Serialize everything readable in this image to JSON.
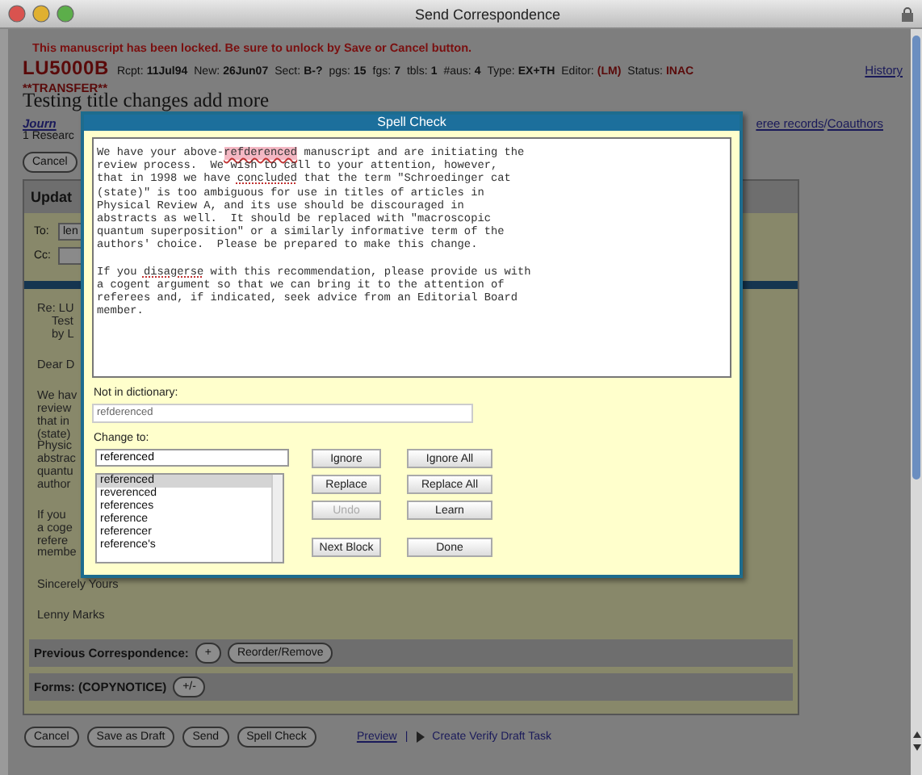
{
  "window": {
    "title": "Send Correspondence"
  },
  "lock_message": "This manuscript has been locked. Be sure to unlock by Save or Cancel button.",
  "manuscript": {
    "code": "LU5000B",
    "fields": [
      {
        "label": "Rcpt:",
        "value": "11Jul94",
        "highlight": false
      },
      {
        "label": "New:",
        "value": "26Jun07",
        "highlight": false
      },
      {
        "label": "Sect:",
        "value": "B-?",
        "highlight": false
      },
      {
        "label": "pgs:",
        "value": "15",
        "highlight": false
      },
      {
        "label": "fgs:",
        "value": "7",
        "highlight": false
      },
      {
        "label": "tbls:",
        "value": "1",
        "highlight": false
      },
      {
        "label": "#aus:",
        "value": "4",
        "highlight": false
      },
      {
        "label": "Type:",
        "value": "EX+TH",
        "highlight": false
      },
      {
        "label": "Editor:",
        "value": "(LM)",
        "highlight": true
      },
      {
        "label": "Status:",
        "value": "INAC",
        "highlight": true
      }
    ],
    "transfer": "**TRANSFER**",
    "history_link": "History",
    "title": "Testing title changes add more",
    "journal_link": "Journ",
    "right_links": [
      "eree records",
      "Coauthors"
    ],
    "link_separator": "/",
    "research_line": "1 Researc"
  },
  "top_buttons": [
    "Cancel"
  ],
  "panel": {
    "header": "Updat",
    "to_label": "To:",
    "to_value": "len",
    "cc_label": "Cc:",
    "letter": [
      [
        {
          "text": "Re: LU",
          "children": [
            {
              "text": "Test"
            },
            {
              "text": "by L"
            }
          ]
        }
      ],
      [
        {
          "text": "Dear D"
        }
      ],
      [
        {
          "text": "We hav"
        },
        {
          "text": "review"
        },
        {
          "text": "that in"
        },
        {
          "text": "(state)"
        },
        {
          "text": "Physic"
        },
        {
          "text": "abstrac"
        },
        {
          "text": "quantu"
        },
        {
          "text": "author"
        }
      ],
      [
        {
          "text": "If you"
        },
        {
          "text": "a coge"
        },
        {
          "text": "refere"
        },
        {
          "text": "membe"
        }
      ],
      [
        {
          "text": "Sincerely Yours"
        }
      ],
      [
        {
          "text": "Lenny Marks"
        }
      ]
    ],
    "sections": [
      {
        "label": "Previous Correspondence:",
        "buttons": [
          "+",
          "Reorder/Remove"
        ]
      },
      {
        "label": "Forms: (COPYNOTICE)",
        "buttons": [
          "+/-"
        ]
      }
    ]
  },
  "bottom_buttons": [
    "Cancel",
    "Save as Draft",
    "Send",
    "Spell Check"
  ],
  "bottom_links": {
    "preview": "Preview",
    "separator": "|",
    "task": "Create Verify Draft Task"
  },
  "spell_check": {
    "title": "Spell Check",
    "paragraphs": [
      [
        [
          {
            "kind": "plain",
            "text": "We have your above-"
          },
          {
            "kind": "current",
            "text": "refderenced"
          },
          {
            "kind": "plain",
            "text": " manuscript and are initiating the"
          }
        ],
        [
          {
            "kind": "plain",
            "text": "review process.  We wish to call to your attention, however,"
          }
        ],
        [
          {
            "kind": "plain",
            "text": "that in 1998 we have "
          },
          {
            "kind": "misspelled",
            "text": "concluded"
          },
          {
            "kind": "plain",
            "text": " that the term \"Schroedinger cat"
          }
        ],
        [
          {
            "kind": "plain",
            "text": "(state)\" is too ambiguous for use in titles of articles in"
          }
        ],
        [
          {
            "kind": "plain",
            "text": "Physical Review A, and its use should be discouraged in"
          }
        ],
        [
          {
            "kind": "plain",
            "text": "abstracts as well.  It should be replaced with \"macroscopic"
          }
        ],
        [
          {
            "kind": "plain",
            "text": "quantum superposition\" or a similarly informative term of the"
          }
        ],
        [
          {
            "kind": "plain",
            "text": "authors' choice.  Please be prepared to make this change."
          }
        ]
      ],
      [
        [
          {
            "kind": "plain",
            "text": "If you "
          },
          {
            "kind": "misspelled",
            "text": "disagerse"
          },
          {
            "kind": "plain",
            "text": " with this recommendation, please provide us with"
          }
        ],
        [
          {
            "kind": "plain",
            "text": "a cogent argument so that we can bring it to the attention of"
          }
        ],
        [
          {
            "kind": "plain",
            "text": "referees and, if indicated, seek advice from an Editorial Board"
          }
        ],
        [
          {
            "kind": "plain",
            "text": "member."
          }
        ]
      ]
    ],
    "not_in_dictionary_label": "Not in dictionary:",
    "not_in_dictionary": "refderenced",
    "change_to_label": "Change to:",
    "change_to": "referenced",
    "suggestions": [
      {
        "text": "referenced",
        "selected": true
      },
      {
        "text": "reverenced",
        "selected": false
      },
      {
        "text": "references",
        "selected": false
      },
      {
        "text": "reference",
        "selected": false
      },
      {
        "text": "referencer",
        "selected": false
      },
      {
        "text": "reference's",
        "selected": false
      }
    ],
    "buttons": [
      [
        {
          "label": "Ignore",
          "disabled": false
        },
        {
          "label": "Ignore All",
          "disabled": false
        }
      ],
      [
        {
          "label": "Replace",
          "disabled": false
        },
        {
          "label": "Replace All",
          "disabled": false
        }
      ],
      [
        {
          "label": "Undo",
          "disabled": true
        },
        {
          "label": "Learn",
          "disabled": false
        }
      ],
      [
        {
          "label": "Next Block",
          "disabled": false
        },
        {
          "label": "Done",
          "disabled": false
        }
      ]
    ]
  }
}
